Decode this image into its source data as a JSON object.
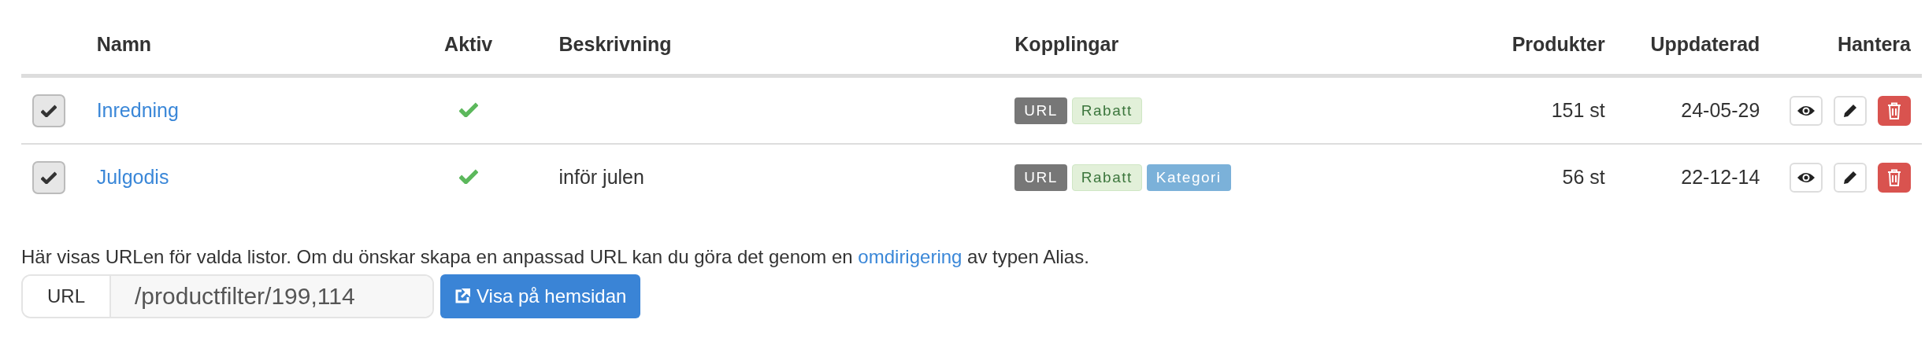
{
  "table": {
    "columns": [
      "Namn",
      "Aktiv",
      "Beskrivning",
      "Kopplingar",
      "Produkter",
      "Uppdaterad",
      "Hantera"
    ],
    "rows": [
      {
        "checked": true,
        "name": "Inredning",
        "active": true,
        "description": "",
        "tags": [
          {
            "kind": "url",
            "label": "URL"
          },
          {
            "kind": "discount",
            "label": "Rabatt"
          }
        ],
        "products": "151 st",
        "updated": "24-05-29"
      },
      {
        "checked": true,
        "name": "Julgodis",
        "active": true,
        "description": "inför julen",
        "tags": [
          {
            "kind": "url",
            "label": "URL"
          },
          {
            "kind": "discount",
            "label": "Rabatt"
          },
          {
            "kind": "category",
            "label": "Kategori"
          }
        ],
        "products": "56 st",
        "updated": "22-12-14"
      }
    ]
  },
  "info": {
    "text": "Här visas URLen för valda listor. Om du önskar skapa en anpassad URL kan du göra det genom en ",
    "link": "omdirigering",
    "text_after": " av typen Alias."
  },
  "url_field": {
    "label": "URL",
    "value": "/productfilter/199,114"
  },
  "show_button": {
    "label": "Visa på hemsidan"
  }
}
